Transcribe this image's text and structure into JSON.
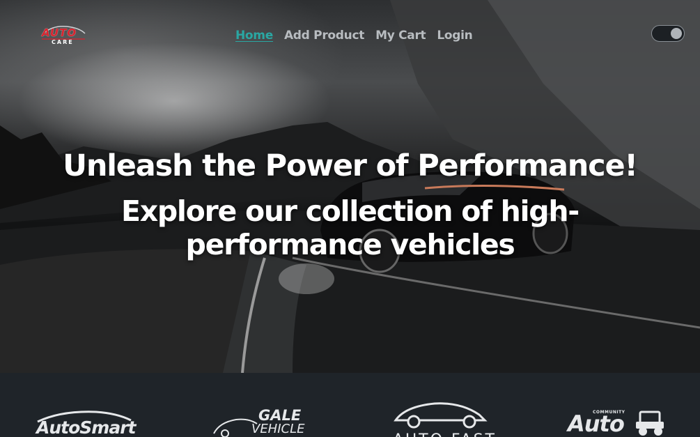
{
  "logo": {
    "top": "AUTO",
    "bottom": "CARE",
    "icon": "car-swoosh-logo"
  },
  "nav": {
    "items": [
      {
        "label": "Home",
        "active": true
      },
      {
        "label": "Add Product",
        "active": false
      },
      {
        "label": "My Cart",
        "active": false
      },
      {
        "label": "Login",
        "active": false
      }
    ]
  },
  "theme_toggle": {
    "icon": "toggle-switch",
    "state": "on"
  },
  "hero": {
    "headline": "Unleash the Power of Performance!",
    "subline": "Explore our collection of high-performance vehicles"
  },
  "brands": {
    "items": [
      {
        "name": "AutoSmart"
      },
      {
        "line1": "GALE",
        "line2": "VEHICLE"
      },
      {
        "name": "AUTO FAST"
      },
      {
        "top": "COMMUNITY",
        "name": "Auto"
      }
    ]
  },
  "colors": {
    "accent": "#2aa7a3",
    "nav_text": "#b8bcc0",
    "brand_bar": "#1f2429",
    "logo_red": "#d9232e"
  }
}
